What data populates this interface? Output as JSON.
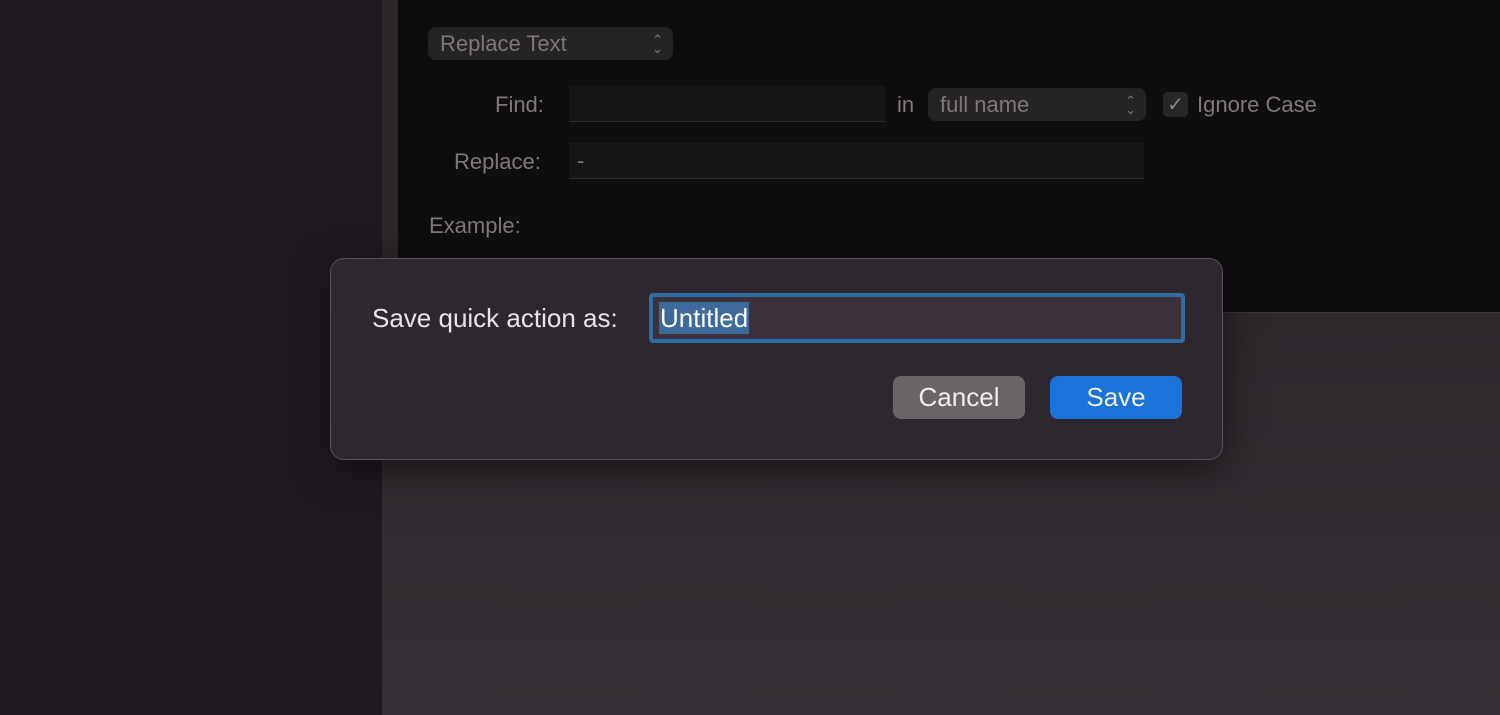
{
  "action": {
    "type_popup": "Replace Text",
    "find_label": "Find:",
    "find_value": "",
    "in_label": "in",
    "scope_popup": "full name",
    "ignore_case_label": "Ignore Case",
    "ignore_case_checked": true,
    "replace_label": "Replace:",
    "replace_value": "-",
    "example_label": "Example:"
  },
  "dialog": {
    "prompt": "Save quick action as:",
    "name_value": "Untitled",
    "cancel_label": "Cancel",
    "save_label": "Save",
    "accent_color": "#1a73d8"
  }
}
